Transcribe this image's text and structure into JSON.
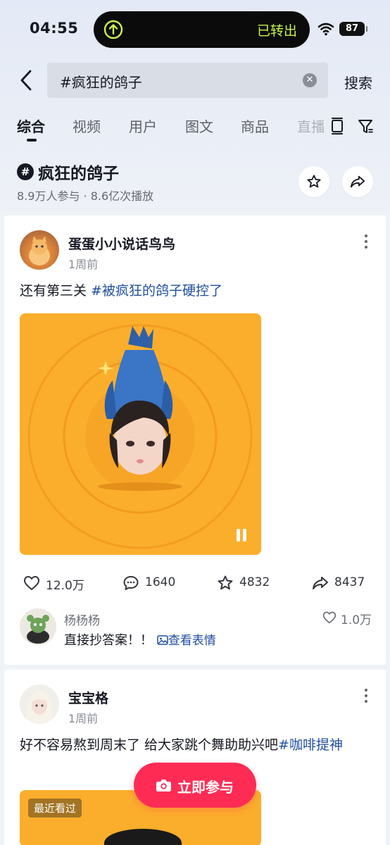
{
  "status_bar": {
    "time": "04:55",
    "island_text": "已转出",
    "battery": "87"
  },
  "search": {
    "query": "#疯狂的鸽子",
    "search_label": "搜索"
  },
  "tabs": [
    {
      "label": "综合",
      "active": true
    },
    {
      "label": "视频"
    },
    {
      "label": "用户"
    },
    {
      "label": "图文"
    },
    {
      "label": "商品"
    },
    {
      "label": "直播"
    }
  ],
  "hashtag": {
    "badge": "#",
    "title": "疯狂的鸽子",
    "stats": "8.9万人参与 · 8.6亿次播放"
  },
  "posts": [
    {
      "author": "蛋蛋小小说话鸟鸟",
      "time": "1周前",
      "caption_text": "还有第三关 ",
      "caption_tag": "#被疯狂的鸽子硬控了",
      "likes": "12.0万",
      "comments": "1640",
      "favorites": "4832",
      "shares": "8437",
      "top_comment": {
        "user": "杨杨杨",
        "text": "直接抄答案！！",
        "link": "查看表情",
        "likes": "1.0万"
      }
    },
    {
      "author": "宝宝格",
      "time": "1周前",
      "caption_text": "好不容易熬到周末了 给大家跳个舞助助兴吧",
      "caption_tag": "#咖啡提神",
      "recent_badge": "最近看过"
    }
  ],
  "join_button": {
    "label": "立即参与"
  },
  "colors": {
    "accent": "#fe2c55",
    "hashtag_link": "#1f4ea0",
    "media_bg": "#fbae2c"
  }
}
